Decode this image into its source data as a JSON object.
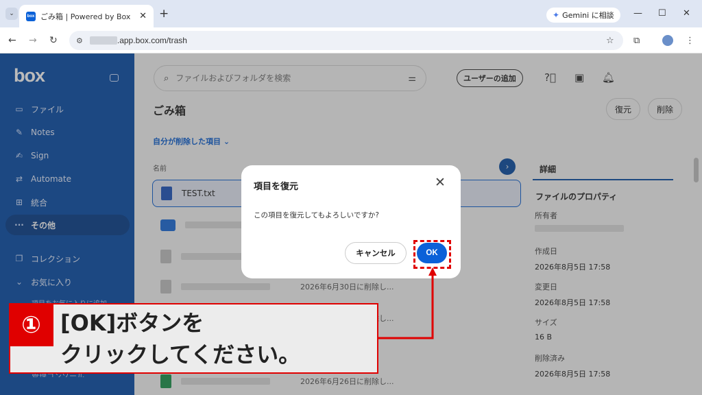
{
  "browser": {
    "tab_title": "ごみ箱 | Powered by Box",
    "favicon_text": "box",
    "gemini_label": "Gemini に相談",
    "url": ".app.box.com/trash"
  },
  "sidebar": {
    "logo": "box",
    "items": [
      {
        "label": "ファイル",
        "icon": "folder-icon"
      },
      {
        "label": "Notes",
        "icon": "notes-icon"
      },
      {
        "label": "Sign",
        "icon": "sign-icon"
      },
      {
        "label": "Automate",
        "icon": "automate-icon"
      },
      {
        "label": "統合",
        "icon": "grid-icon"
      },
      {
        "label": "その他",
        "icon": "more-icon"
      },
      {
        "label": "コレクション",
        "icon": "collection-icon"
      },
      {
        "label": "お気に入り",
        "icon": "chevron-down-icon"
      }
    ],
    "fav_hint": "項目をお気に入りに追加",
    "admin": "管理コンソール"
  },
  "header": {
    "search_placeholder": "ファイルおよびフォルダを検索",
    "add_user": "ユーザーの追加"
  },
  "page": {
    "title": "ごみ箱",
    "restore": "復元",
    "delete": "削除",
    "filter": "自分が削除した項目",
    "col_name": "名前",
    "col_detail": "詳細",
    "selected_file": "TEST.txt",
    "rows": [
      "",
      "",
      "2026年6月30日に削除し...",
      "2026年6月26日に削除し...",
      "",
      "2026年6月26日に削除し..."
    ]
  },
  "panel": {
    "tab": "詳細",
    "section": "ファイルのプロパティ",
    "owner_label": "所有者",
    "created_label": "作成日",
    "created_value": "2026年8月5日 17:58",
    "modified_label": "変更日",
    "modified_value": "2026年8月5日 17:58",
    "size_label": "サイズ",
    "size_value": "16 B",
    "deleted_label": "削除済み",
    "deleted_value": "2026年8月5日 17:58"
  },
  "dialog": {
    "title": "項目を復元",
    "message": "この項目を復元してもよろしいですか?",
    "cancel": "キャンセル",
    "ok": "OK"
  },
  "annotation": {
    "badge": "①",
    "line1": "[OK]ボタンを",
    "line2": "クリックしてください。",
    "color": "#e00000"
  }
}
